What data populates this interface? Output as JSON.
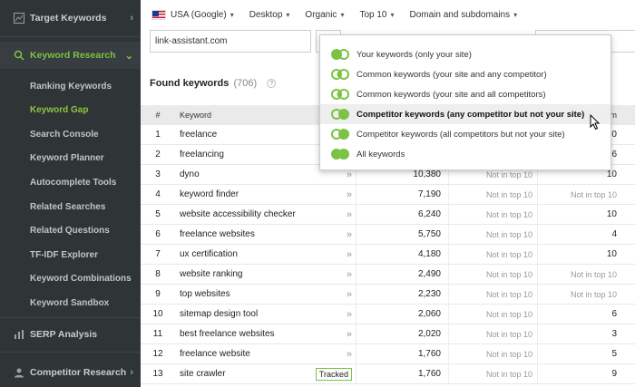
{
  "sidebar": {
    "sections": [
      {
        "label": "Target Keywords",
        "icon": "chart-icon",
        "chevron": "›"
      },
      {
        "label": "Keyword Research",
        "icon": "search-icon",
        "chevron": "⌄"
      },
      {
        "label": "SERP Analysis",
        "icon": "bar-chart-icon",
        "chevron": ""
      },
      {
        "label": "Competitor Research",
        "icon": "user-icon",
        "chevron": "›"
      }
    ],
    "items": [
      "Ranking Keywords",
      "Keyword Gap",
      "Search Console",
      "Keyword Planner",
      "Autocomplete Tools",
      "Related Searches",
      "Related Questions",
      "TF-IDF Explorer",
      "Keyword Combinations",
      "Keyword Sandbox"
    ],
    "active_item": "Keyword Gap"
  },
  "topbar": {
    "country": "USA (Google)",
    "device": "Desktop",
    "result_type": "Organic",
    "top": "Top 10",
    "scope": "Domain and subdomains"
  },
  "domain_input": {
    "value": "link-assistant.com"
  },
  "found": {
    "label": "Found keywords",
    "count": "(706)",
    "help": "?"
  },
  "table": {
    "headers": {
      "num": "#",
      "keyword": "Keyword",
      "last": "om"
    },
    "rows": [
      {
        "num": "1",
        "kw": "freelance",
        "action": "»",
        "vol": "",
        "a": "",
        "b": "10"
      },
      {
        "num": "2",
        "kw": "freelancing",
        "action": "»",
        "vol": "",
        "a": "",
        "b": "6"
      },
      {
        "num": "3",
        "kw": "dyno",
        "action": "»",
        "vol": "10,380",
        "a": "Not in top 10",
        "b": "10"
      },
      {
        "num": "4",
        "kw": "keyword finder",
        "action": "»",
        "vol": "7,190",
        "a": "Not in top 10",
        "b": "Not in top 10"
      },
      {
        "num": "5",
        "kw": "website accessibility checker",
        "action": "»",
        "vol": "6,240",
        "a": "Not in top 10",
        "b": "10"
      },
      {
        "num": "6",
        "kw": "freelance websites",
        "action": "»",
        "vol": "5,750",
        "a": "Not in top 10",
        "b": "4"
      },
      {
        "num": "7",
        "kw": "ux certification",
        "action": "»",
        "vol": "4,180",
        "a": "Not in top 10",
        "b": "10"
      },
      {
        "num": "8",
        "kw": "website ranking",
        "action": "»",
        "vol": "2,490",
        "a": "Not in top 10",
        "b": "Not in top 10"
      },
      {
        "num": "9",
        "kw": "top websites",
        "action": "»",
        "vol": "2,230",
        "a": "Not in top 10",
        "b": "Not in top 10"
      },
      {
        "num": "10",
        "kw": "sitemap design tool",
        "action": "»",
        "vol": "2,060",
        "a": "Not in top 10",
        "b": "6"
      },
      {
        "num": "11",
        "kw": "best freelance websites",
        "action": "»",
        "vol": "2,020",
        "a": "Not in top 10",
        "b": "3"
      },
      {
        "num": "12",
        "kw": "freelance website",
        "action": "»",
        "vol": "1,760",
        "a": "Not in top 10",
        "b": "5"
      },
      {
        "num": "13",
        "kw": "site crawler",
        "action": "Tracked",
        "vol": "1,760",
        "a": "Not in top 10",
        "b": "9"
      }
    ]
  },
  "dropdown": {
    "items": [
      {
        "label": "Your keywords (only your site)",
        "venn": "fill-l"
      },
      {
        "label": "Common keywords (your site and any competitor)",
        "venn": "fill-mid"
      },
      {
        "label": "Common keywords (your site and all competitors)",
        "venn": "fill-mid"
      },
      {
        "label": "Competitor keywords (any competitor but not your site)",
        "venn": "fill-r"
      },
      {
        "label": "Competitor keywords (all competitors but not your site)",
        "venn": "fill-r"
      },
      {
        "label": "All keywords",
        "venn": "fill-both"
      }
    ],
    "highlighted_index": 3
  },
  "colors": {
    "accent": "#7cc243",
    "sidebar_bg": "#2f3437"
  }
}
